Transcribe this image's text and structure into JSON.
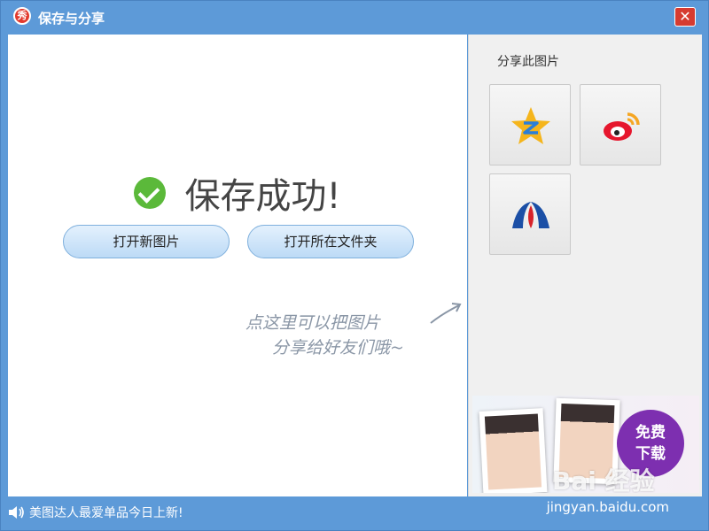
{
  "window": {
    "title": "保存与分享",
    "close_label": "✕",
    "logo_text": "秀"
  },
  "main": {
    "success_text": "保存成功!",
    "buttons": {
      "open_new_image": "打开新图片",
      "open_folder": "打开所在文件夹"
    },
    "hint": {
      "line1": "点这里可以把图片",
      "line2": "分享给好友们哦~"
    }
  },
  "sidebar": {
    "share_title": "分享此图片",
    "targets": [
      {
        "icon": "qzone-icon"
      },
      {
        "icon": "weibo-icon"
      },
      {
        "icon": "renren-icon"
      }
    ],
    "ad": {
      "download_line1": "免费",
      "download_line2": "下载",
      "watermark": "Bai 经验"
    }
  },
  "footer": {
    "news_text": "美图达人最爱单品今日上新!",
    "url": "jingyan.baidu.com"
  },
  "colors": {
    "titlebar": "#5d9ad8",
    "success": "#5bb93a",
    "button": "#bcdaf6",
    "badge": "#7d2fb0",
    "close": "#d63b30"
  }
}
